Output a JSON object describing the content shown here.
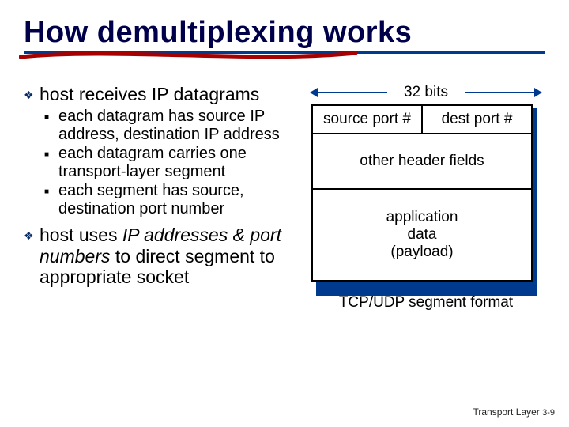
{
  "title": "How demultiplexing works",
  "bullets": {
    "b1": "host receives IP datagrams",
    "b1subs": {
      "s1": "each datagram has source IP address, destination IP address",
      "s2": "each datagram carries one transport-layer segment",
      "s3": "each segment has source, destination port number"
    },
    "b2_pre": "host uses ",
    "b2_em": "IP addresses & port numbers",
    "b2_post": " to direct segment to appropriate socket"
  },
  "diagram": {
    "bits": "32 bits",
    "srcport": "source port #",
    "dstport": "dest port #",
    "other": "other header fields",
    "payload_l1": "application",
    "payload_l2": "data",
    "payload_l3": "(payload)",
    "caption": "TCP/UDP segment format"
  },
  "footer": {
    "section": "Transport Layer",
    "page": "3-9"
  }
}
